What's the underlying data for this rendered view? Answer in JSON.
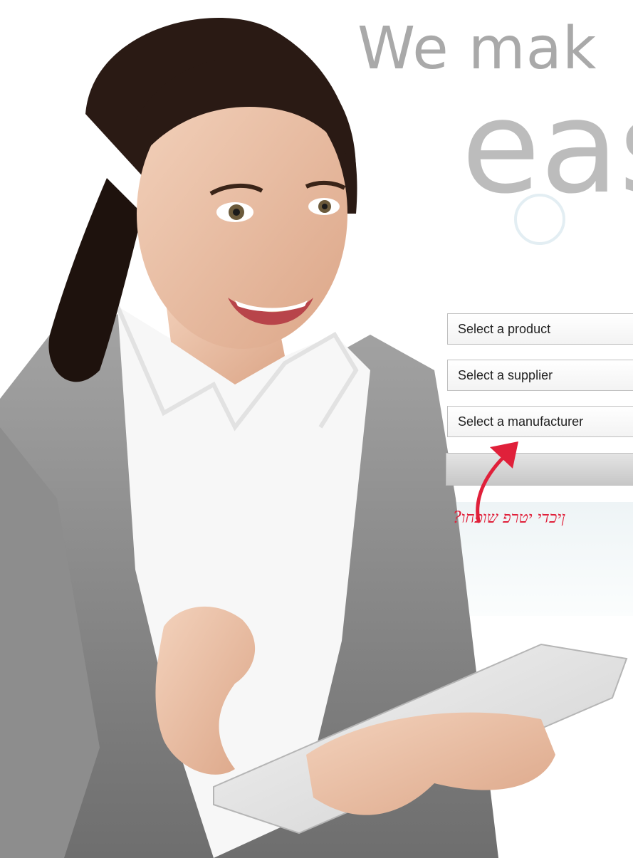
{
  "headline": {
    "line1": "We mak",
    "line2": "eas"
  },
  "form": {
    "product_select": "Select a product",
    "supplier_select": "Select a supplier",
    "manufacturer_select": "Select a manufacturer"
  },
  "annotation": {
    "handwritten_note": "?ןיכדי יטרפ שופחו"
  },
  "colors": {
    "headline": "#a9a9a9",
    "annotation": "#e0203a",
    "button": "#d6d6d6"
  },
  "icons": {
    "clock": "clock-icon",
    "arrow": "red-arrow-icon"
  }
}
